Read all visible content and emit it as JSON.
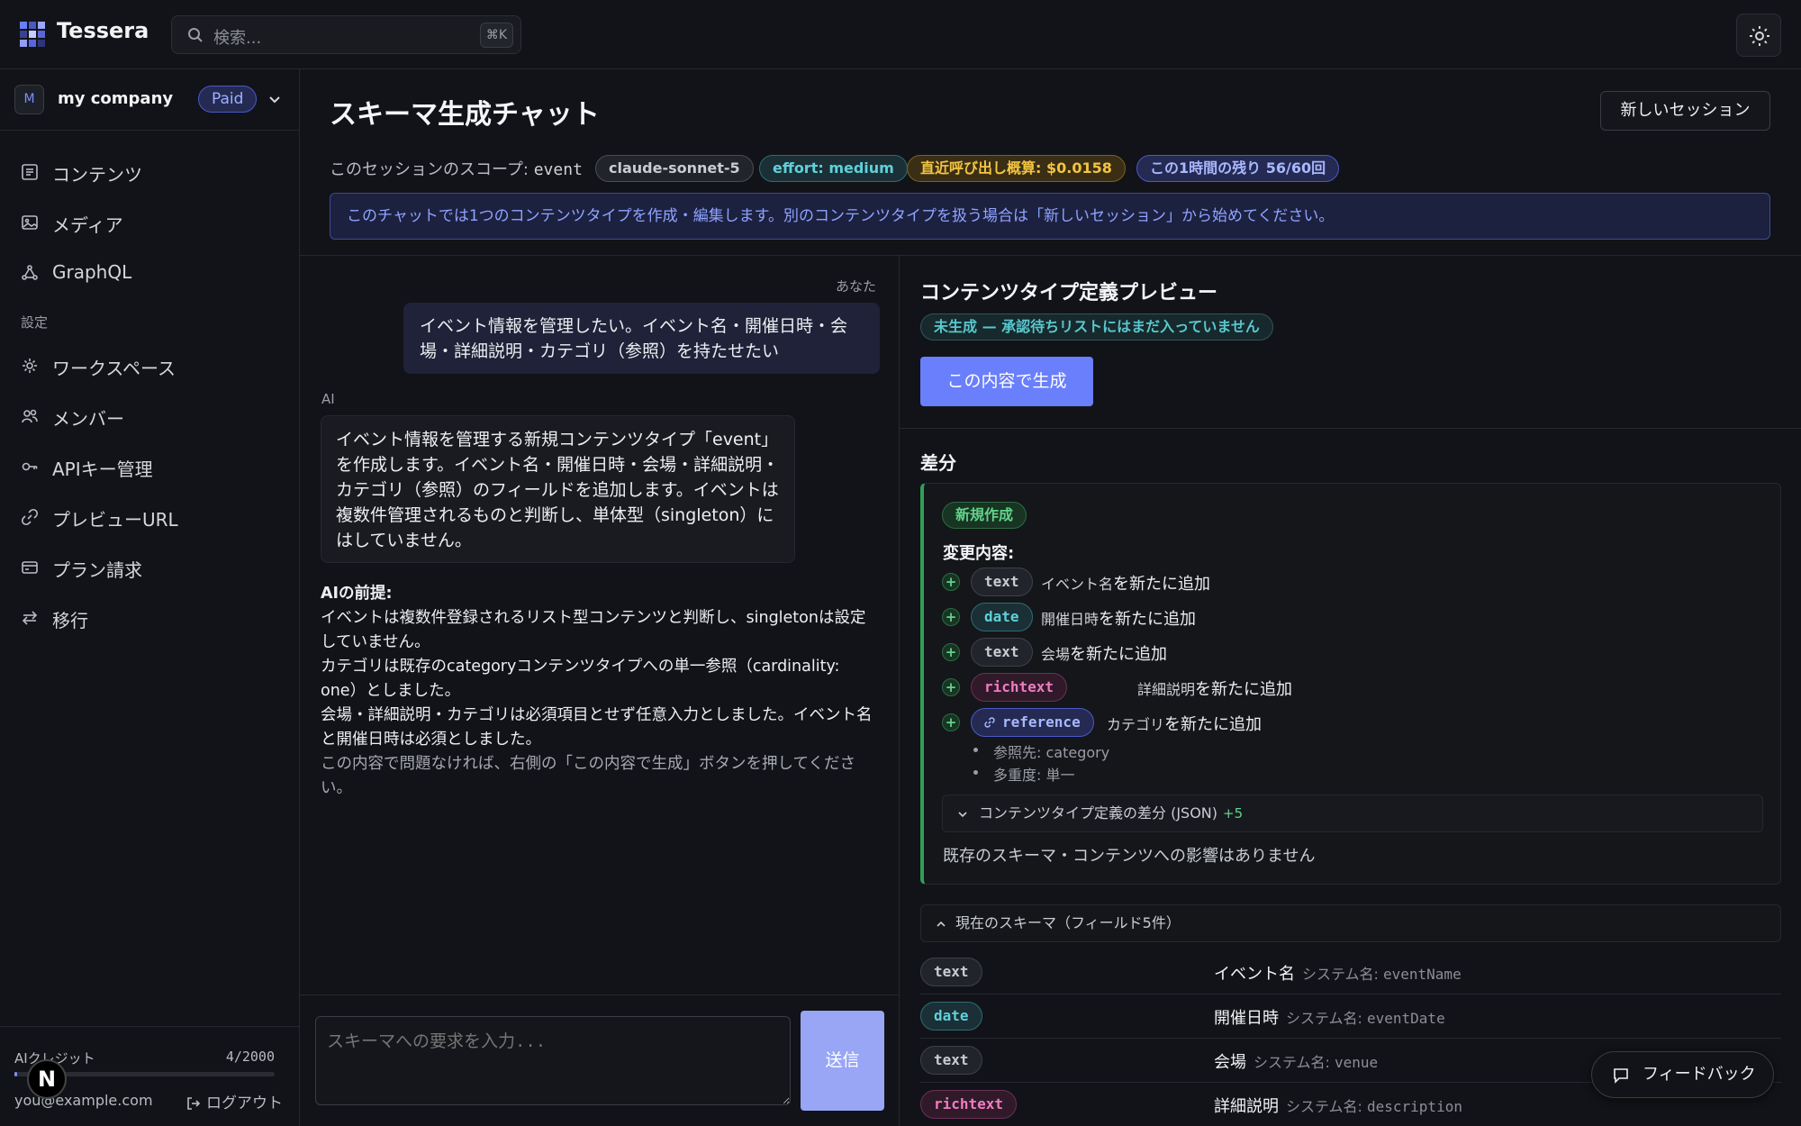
{
  "app": {
    "brand": "Tessera",
    "search_placeholder": "検索...",
    "search_shortcut": "⌘K"
  },
  "workspace": {
    "avatar": "M",
    "name": "my company",
    "plan": "Paid"
  },
  "sidebar": {
    "items": [
      {
        "label": "コンテンツ",
        "icon": "document-icon"
      },
      {
        "label": "メディア",
        "icon": "image-icon"
      },
      {
        "label": "GraphQL",
        "icon": "graphql-icon"
      }
    ],
    "settings_label": "設定",
    "settings_items": [
      {
        "label": "ワークスペース",
        "icon": "gear-icon"
      },
      {
        "label": "メンバー",
        "icon": "users-icon"
      },
      {
        "label": "APIキー管理",
        "icon": "key-icon"
      },
      {
        "label": "プレビューURL",
        "icon": "link-icon"
      },
      {
        "label": "プラン請求",
        "icon": "credit-card-icon"
      },
      {
        "label": "移行",
        "icon": "transfer-icon"
      }
    ],
    "credits_label": "AIクレジット",
    "credits_count": "4/2000",
    "credits_fraction": 0.002,
    "email": "you@example.com",
    "logout": "ログアウト",
    "n_badge": "N"
  },
  "header": {
    "title": "スキーマ生成チャット",
    "new_session": "新しいセッション",
    "scope_label": "このセッションのスコープ: ",
    "scope_value": "event",
    "model": "claude-sonnet-5",
    "effort": "effort: medium",
    "cost": "直近呼び出し概算: $0.0158",
    "remaining": "この1時間の残り 56/60回",
    "info": "このチャットでは1つのコンテンツタイプを作成・編集します。別のコンテンツタイプを扱う場合は「新しいセッション」から始めてください。"
  },
  "chat": {
    "user_label": "あなた",
    "user_message": "イベント情報を管理したい。イベント名・開催日時・会場・詳細説明・カテゴリ（参照）を持たせたい",
    "ai_label": "AI",
    "ai_message": "イベント情報を管理する新規コンテンツタイプ「event」を作成します。イベント名・開催日時・会場・詳細説明・カテゴリ（参照）のフィールドを追加します。イベントは複数件管理されるものと判断し、単体型（singleton）にはしていません。",
    "premises_title": "AIの前提:",
    "premises": [
      "イベントは複数件登録されるリスト型コンテンツと判断し、singletonは設定していません。",
      "カテゴリは既存のcategoryコンテンツタイプへの単一参照（cardinality: one）としました。",
      "会場・詳細説明・カテゴリは必須項目とせず任意入力としました。イベント名と開催日時は必須としました。"
    ],
    "closing": "この内容で問題なければ、右側の「この内容で生成」ボタンを押してください。",
    "input_placeholder": "スキーマへの要求を入力...",
    "send": "送信"
  },
  "preview": {
    "title": "コンテンツタイプ定義プレビュー",
    "status": "未生成 — 承認待ちリストにはまだ入っていません",
    "generate": "この内容で生成",
    "diff_title": "差分",
    "new_badge": "新規作成",
    "changes_label": "変更内容:",
    "changes": [
      {
        "type": "text",
        "name": "イベント名",
        "suffix": "を新たに追加"
      },
      {
        "type": "date",
        "name": "開催日時",
        "suffix": "を新たに追加"
      },
      {
        "type": "text",
        "name": "会場",
        "suffix": "を新たに追加"
      },
      {
        "type": "richtext",
        "name": "詳細説明",
        "suffix": "を新たに追加"
      },
      {
        "type": "reference",
        "name": "カテゴリ",
        "suffix": "を新たに追加"
      }
    ],
    "ref_target": "参照先: category",
    "ref_cardinality": "多重度: 単一",
    "json_diff": "コンテンツタイプ定義の差分 (JSON)",
    "json_plus": "+5",
    "no_impact": "既存のスキーマ・コンテンツへの影響はありません",
    "current_schema": "現在のスキーマ（フィールド5件）",
    "sys_prefix": "システム名: ",
    "fields": [
      {
        "type": "text",
        "name": "イベント名",
        "sys": "eventName"
      },
      {
        "type": "date",
        "name": "開催日時",
        "sys": "eventDate"
      },
      {
        "type": "text",
        "name": "会場",
        "sys": "venue"
      },
      {
        "type": "richtext",
        "name": "詳細説明",
        "sys": "description"
      }
    ]
  },
  "feedback": "フィードバック",
  "colors": {
    "accent": "#6a7ffb",
    "bg": "#121318",
    "green": "#63d38b",
    "cyan": "#5fd0da",
    "pink": "#f07cc0",
    "amber": "#f3c443"
  }
}
